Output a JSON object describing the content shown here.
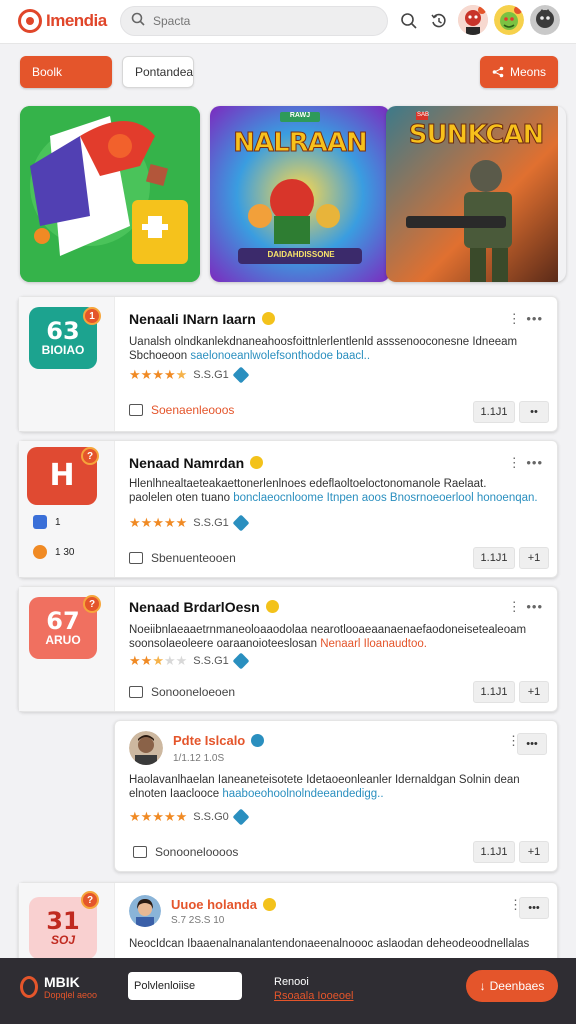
{
  "header": {
    "logo_text": "Imendia",
    "search_placeholder": "Spacta",
    "icons": [
      "search-icon",
      "history-icon"
    ],
    "avatars": [
      "avatar-red-hero",
      "avatar-green-goblin",
      "avatar-dark-character"
    ]
  },
  "filters": {
    "left_button": "Boolk",
    "middle_button": "Pontandea",
    "right_button": "Meons"
  },
  "banners": [
    {
      "title": "",
      "theme": "colorful-shapes"
    },
    {
      "title": "NALRAAN",
      "subtitle": "DAIDAHDISSONE",
      "badge": "RAWJ"
    },
    {
      "title": "SUNKCAN",
      "badge": "SAB"
    }
  ],
  "cards": [
    {
      "icon_big": "63",
      "icon_small": "BIOIAO",
      "icon_color": "#1ca38f",
      "badge": "1",
      "title": "Nenaali INarn Iaarn",
      "desc_line1": "Uanalsh olndkanlekdnaneahoosfoittnlerlentlenld asssenooconesne Idneeam",
      "desc_line2_plain": "Sbchoeoon",
      "desc_line2_link": "saelonoeanlwolefsonthodoe baacl..",
      "rating_stars": 4.5,
      "rating_text": "S.S.G1",
      "action_label": "Soenaenleooos",
      "action_label_orange": true,
      "pill_left": "1.1J1",
      "pill_right": "••"
    },
    {
      "icon_big": "H",
      "icon_small": "",
      "icon_color": "#e04a32",
      "badge": "?",
      "side_labels": [
        "1",
        "1 30"
      ],
      "title": "Nenaad Namrdan",
      "desc_line1": "Hlenlhnealtaeteakaettonerlenlnoes edeflaoltoeloctonomanole Raelaat.",
      "desc_line2_plain": "paolelen oten tuano",
      "desc_line2_link": "bonclaeocnloome Itnpen aoos Bnosrnoeoerlool honoenqan.",
      "rating_stars": 5,
      "rating_text": "S.S.G1",
      "action_label": "Sbenuenteooen",
      "action_label_orange": false,
      "pill_left": "1.1J1",
      "pill_right": "+1"
    },
    {
      "icon_big": "67",
      "icon_small": "ARUO",
      "icon_color": "#f07060",
      "badge": "?",
      "title": "Nenaad BrdarlOesn",
      "desc_line1": "Noeiibnlaeaaetrnmaneoloaaodolaa nearotlooaeaanaenaefaodoneisetealeoam",
      "desc_line2_plain": "soonsolaeoleere oaraanoioteeslosan",
      "desc_line2_link": "Nenaarl Iloanaudtoo.",
      "rating_stars": 2.5,
      "rating_text": "S.S.G1",
      "action_label": "Sonooneloeoen",
      "action_label_orange": false,
      "pill_left": "1.1J1",
      "pill_right": "+1"
    },
    {
      "avatar": "avatar-man",
      "title": "Pdte Islcalo",
      "title_orange": true,
      "subtitle": "1/1.12 1.0S",
      "desc_line1": "Haolavanlhaelan Ianeaneteisotete Idetaoeonleanler Idernaldgan Solnin dean",
      "desc_line2_plain": "elnoten Iaaclooce",
      "desc_line2_link": "haaboeohoolnolndeeandedigg..",
      "rating_stars": 5,
      "rating_text": "S.S.G0",
      "action_label": "Sonooneloooos",
      "action_label_orange": false,
      "pill_left": "1.1J1",
      "pill_right": "+1"
    },
    {
      "avatar": "avatar-girl",
      "icon_big": "31",
      "icon_small": "SOJ",
      "badge": "?",
      "title": "Uuoe holanda",
      "title_orange": true,
      "subtitle": "S.7 2S.S 10",
      "desc_line1": "NeocIdcan Ibaaenalnanalantendonaeenalnoooc aslaodan deheodeoodnellalas",
      "pill_right": "•••"
    }
  ],
  "bottom": {
    "logo_text": "MBIK",
    "logo_sub": "Dopqlel aeoo",
    "input_value": "Polvlenloiise",
    "right_label": "Renooi",
    "right_link": "Rsoaala Iooeoel",
    "button_label": "Deenbaes"
  },
  "colors": {
    "accent": "#e4552b",
    "link": "#2a8fbf",
    "star": "#f08a24"
  }
}
